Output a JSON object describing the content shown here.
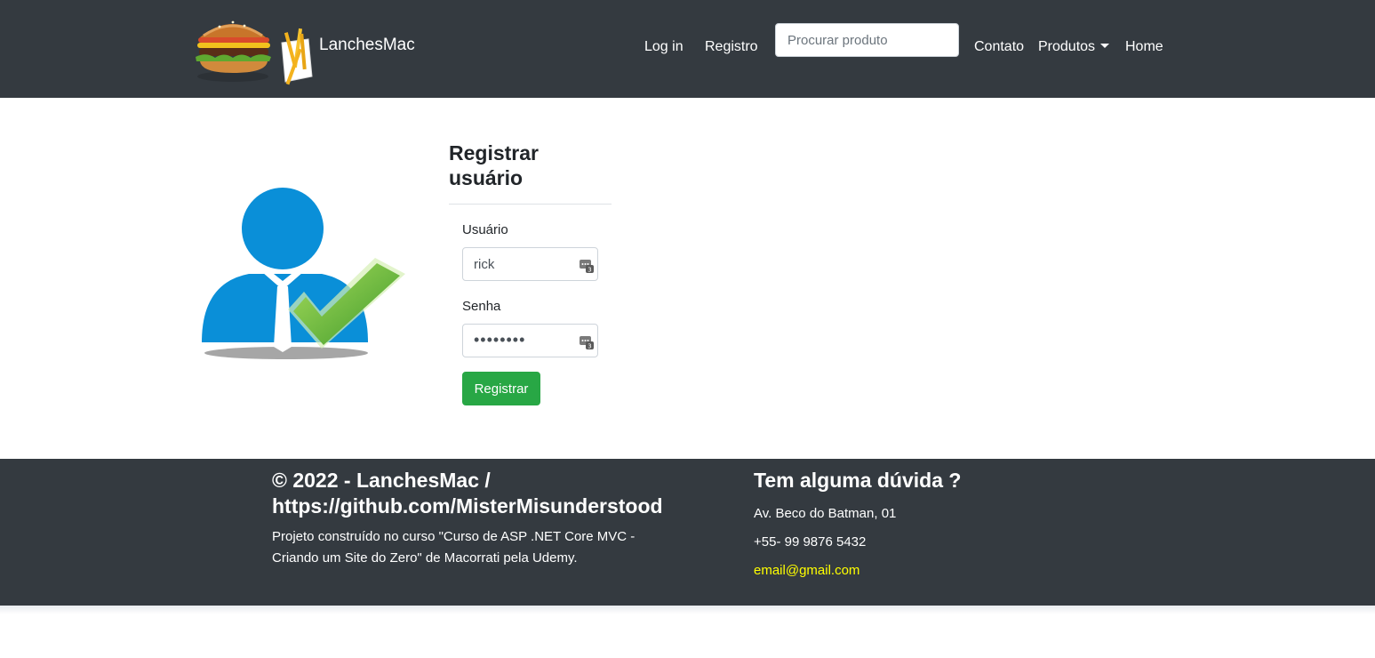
{
  "header": {
    "brand": "LanchesMac",
    "nav": {
      "login": "Log in",
      "register": "Registro",
      "search_placeholder": "Procurar produto",
      "contact": "Contato",
      "products": "Produtos",
      "home": "Home"
    }
  },
  "form": {
    "title": "Registrar usuário",
    "username_label": "Usuário",
    "username_value": "rick",
    "password_label": "Senha",
    "password_value": "••••••••",
    "submit_label": "Registrar"
  },
  "footer": {
    "copyright": "© 2022 - LanchesMac / https://github.com/MisterMisunderstood",
    "description": "Projeto construído no curso \"Curso de ASP .NET Core MVC - Criando um Site do Zero\" de Macorrati pela Udemy.",
    "contact_title": "Tem alguma dúvida ?",
    "address": "Av. Beco do Batman, 01",
    "phone": "+55- 99 9876 5432",
    "email": "email@gmail.com"
  },
  "colors": {
    "navbar_bg": "#343a40",
    "button_success": "#28a745",
    "email_link": "#ffff00",
    "avatar_blue": "#0a8fd8",
    "check_green": "#6cc24a"
  },
  "icons": [
    "burger-logo-icon",
    "caret-down-icon",
    "user-check-icon",
    "password-manager-icon"
  ]
}
